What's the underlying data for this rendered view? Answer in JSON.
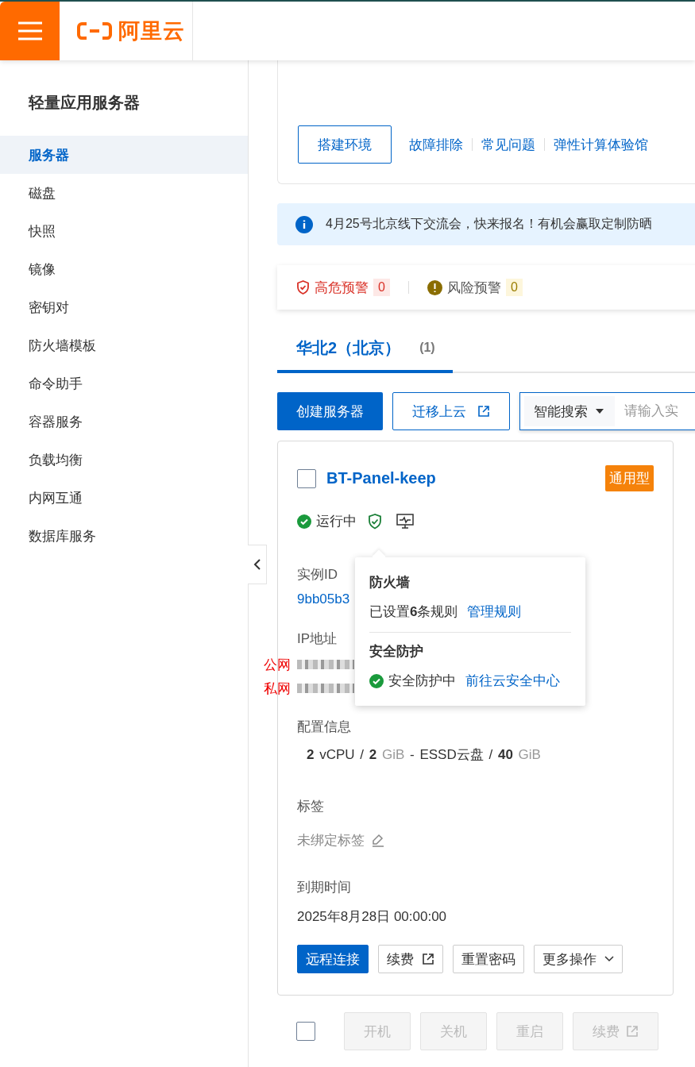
{
  "header": {
    "logo_text": "阿里云"
  },
  "sidebar": {
    "title": "轻量应用服务器",
    "items": [
      {
        "label": "服务器",
        "selected": true
      },
      {
        "label": "磁盘",
        "selected": false
      },
      {
        "label": "快照",
        "selected": false
      },
      {
        "label": "镜像",
        "selected": false
      },
      {
        "label": "密钥对",
        "selected": false
      },
      {
        "label": "防火墙模板",
        "selected": false
      },
      {
        "label": "命令助手",
        "selected": false
      },
      {
        "label": "容器服务",
        "selected": false
      },
      {
        "label": "负载均衡",
        "selected": false
      },
      {
        "label": "内网互通",
        "selected": false
      },
      {
        "label": "数据库服务",
        "selected": false
      }
    ]
  },
  "top_card": {
    "button": "搭建环境",
    "links": [
      "故障排除",
      "常见问题",
      "弹性计算体验馆"
    ]
  },
  "notice": "4月25号北京线下交流会，快来报名！有机会赢取定制防晒",
  "alerts": [
    {
      "kind": "high",
      "label": "高危预警",
      "count": "0"
    },
    {
      "kind": "risk",
      "label": "风险预警",
      "count": "0"
    }
  ],
  "region_tabs": [
    {
      "label": "华北2（北京）",
      "count": "(1)",
      "selected": true
    }
  ],
  "toolbar": {
    "create": "创建服务器",
    "migrate": "迁移上云",
    "search_mode": "智能搜索",
    "search_placeholder": "请输入实"
  },
  "server": {
    "checked": false,
    "name": "BT-Panel-keep",
    "type_tag": "通用型",
    "status": "运行中",
    "instance_id_label": "实例ID",
    "instance_id": "9bb05b3",
    "ip_label": "IP地址",
    "ip_rows": [
      {
        "label": "公网"
      },
      {
        "label": "私网"
      }
    ],
    "config_label": "配置信息",
    "config_parts": [
      {
        "text": "2",
        "kind": "strong"
      },
      {
        "text": "vCPU /",
        "kind": "plain"
      },
      {
        "text": "2",
        "kind": "strong"
      },
      {
        "text": "GiB",
        "kind": "muted"
      },
      {
        "text": "- ESSD云盘 /",
        "kind": "plain"
      },
      {
        "text": "40",
        "kind": "strong"
      },
      {
        "text": "GiB",
        "kind": "muted"
      }
    ],
    "tag_label": "标签",
    "tag_value": "未绑定标签",
    "expiry_label": "到期时间",
    "expiry": "2025年8月28日 00:00:00",
    "actions": [
      {
        "label": "远程连接",
        "kind": "primary"
      },
      {
        "label": "续费",
        "kind": "external"
      },
      {
        "label": "重置密码",
        "kind": "plain"
      },
      {
        "label": "更多操作",
        "kind": "menu"
      }
    ]
  },
  "popover": {
    "firewall_title": "防火墙",
    "firewall_text": "已设置**6**条规则",
    "firewall_link": "管理规则",
    "security_title": "安全防护",
    "security_text": "安全防护中",
    "security_link": "前往云安全中心"
  },
  "batch": {
    "checked": false,
    "buttons": [
      {
        "label": "开机",
        "disabled": true,
        "external": false
      },
      {
        "label": "关机",
        "disabled": true,
        "external": false
      },
      {
        "label": "重启",
        "disabled": true,
        "external": false
      },
      {
        "label": "续费",
        "disabled": true,
        "external": true
      }
    ]
  }
}
